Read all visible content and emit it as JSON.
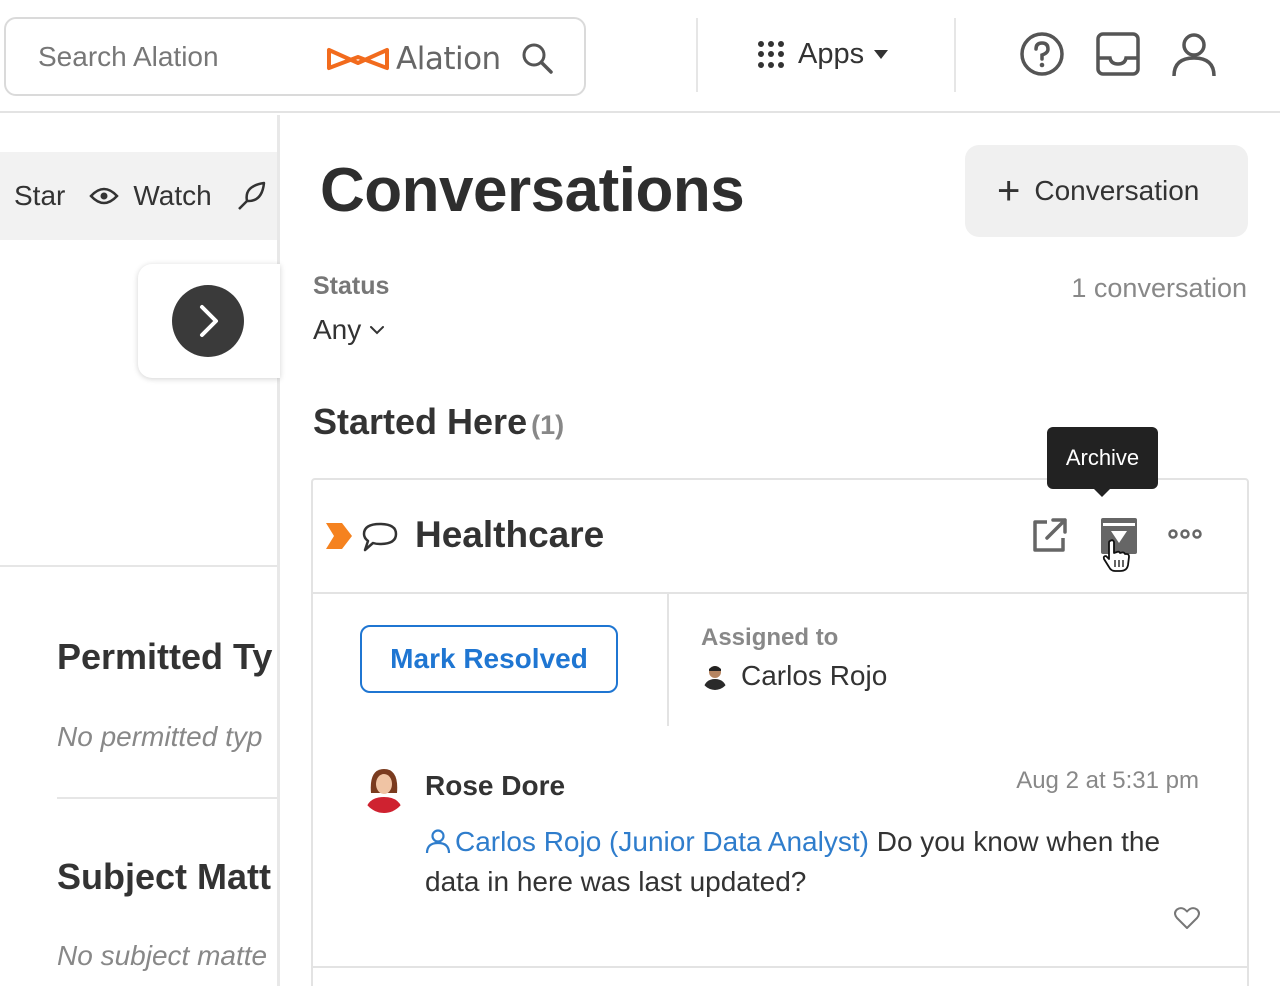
{
  "header": {
    "search_placeholder": "Search Alation",
    "logo_text": "Alation",
    "apps_label": "Apps"
  },
  "left_page": {
    "actions": {
      "star": "Star",
      "watch": "Watch"
    },
    "sections": [
      {
        "title": "Permitted Ty",
        "empty_text": "No permitted typ"
      },
      {
        "title": "Subject Matt",
        "empty_text": "No subject matte"
      }
    ]
  },
  "conversations": {
    "title": "Conversations",
    "new_button": "Conversation",
    "status_label": "Status",
    "status_value": "Any",
    "count_text": "1 conversation",
    "section_title": "Started Here",
    "section_count": "(1)",
    "tooltip": "Archive",
    "card": {
      "title": "Healthcare",
      "resolve_button": "Mark Resolved",
      "assigned_label": "Assigned to",
      "assignee": "Carlos Rojo",
      "message": {
        "author": "Rose Dore",
        "time": "Aug 2 at 5:31 pm",
        "mention": "Carlos Rojo (Junior Data Analyst)",
        "text": " Do you know when the data in here was last updated?"
      }
    }
  },
  "colors": {
    "accent_blue": "#1f76d2",
    "logo_orange": "#f26b1d",
    "flag_orange": "#f5821f"
  }
}
